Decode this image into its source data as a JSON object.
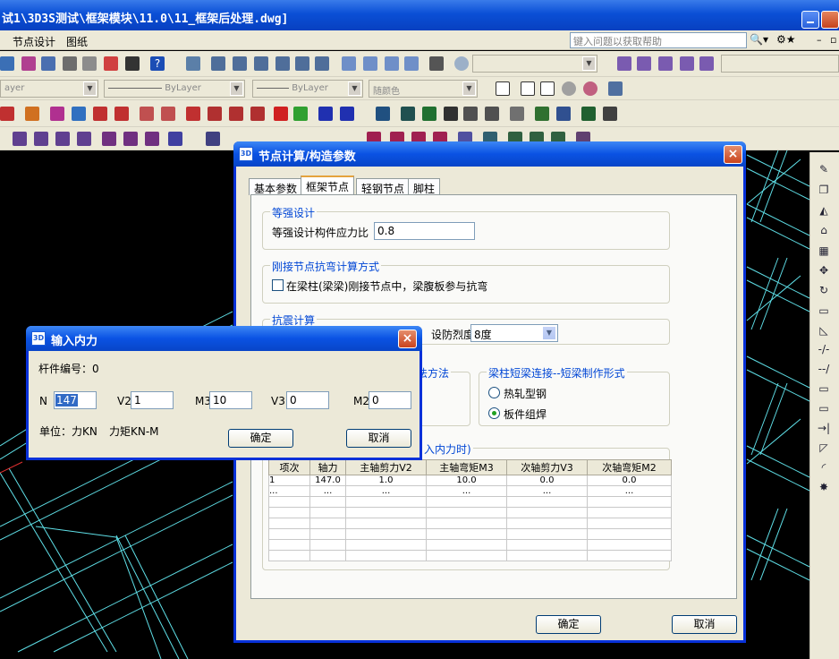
{
  "app": {
    "title": "试1\\3D3S测试\\框架模块\\11.0\\11_框架后处理.dwg]"
  },
  "menu": {
    "items": [
      "节点设计",
      "图纸"
    ],
    "help_placeholder": "键入问题以获取帮助"
  },
  "layer_bar": {
    "layer": "ayer",
    "linetype": "ByLayer",
    "lineweight": "ByLayer",
    "color": "随颜色"
  },
  "main_dialog": {
    "title": "节点计算/构造参数",
    "tabs": [
      "基本参数",
      "框架节点",
      "轻钢节点",
      "脚柱"
    ],
    "active_tab": "框架节点",
    "equal_strength": {
      "legend": "等强设计",
      "label": "等强设计构件应力比",
      "value": "0.8"
    },
    "rigid": {
      "legend": "刚接节点抗弯计算方式",
      "checkbox_label": "在梁柱(梁梁)刚接节点中，梁腹板参与抗弯",
      "checked": false
    },
    "seismic": {
      "legend": "抗震计算",
      "intensity_label": "设防烈度",
      "intensity_value": "8度"
    },
    "method_legend_fragment": "法方法",
    "short_beam": {
      "legend": "梁柱短梁连接--短梁制作形式",
      "options": [
        "热轧型钢",
        "板件组焊"
      ],
      "selected": "板件组焊"
    },
    "forces_legend_fragment": "入内力时)",
    "table": {
      "headers": [
        "项次",
        "轴力",
        "主轴剪力V2",
        "主轴弯矩M3",
        "次轴剪力V3",
        "次轴弯矩M2"
      ],
      "rows": [
        [
          "1",
          "147.0",
          "1.0",
          "10.0",
          "0.0",
          "0.0"
        ],
        [
          "...",
          "...",
          "...",
          "...",
          "...",
          "..."
        ]
      ]
    },
    "ok_label": "确定",
    "cancel_label": "取消"
  },
  "force_dialog": {
    "title": "输入内力",
    "member_label": "杆件编号：0",
    "fields": [
      {
        "label": "N",
        "value": "147"
      },
      {
        "label": "V2",
        "value": "1"
      },
      {
        "label": "M3",
        "value": "10"
      },
      {
        "label": "V3",
        "value": "0"
      },
      {
        "label": "M2",
        "value": "0"
      }
    ],
    "unit_label": "单位：力KN",
    "moment_label": "力矩KN-M",
    "ok_label": "确定",
    "cancel_label": "取消"
  },
  "colors": {
    "xp_blue": "#0a52e3",
    "dialog_face": "#ece9d8",
    "cad_background": "#000000",
    "cad_lines": "#5fe0e8"
  }
}
